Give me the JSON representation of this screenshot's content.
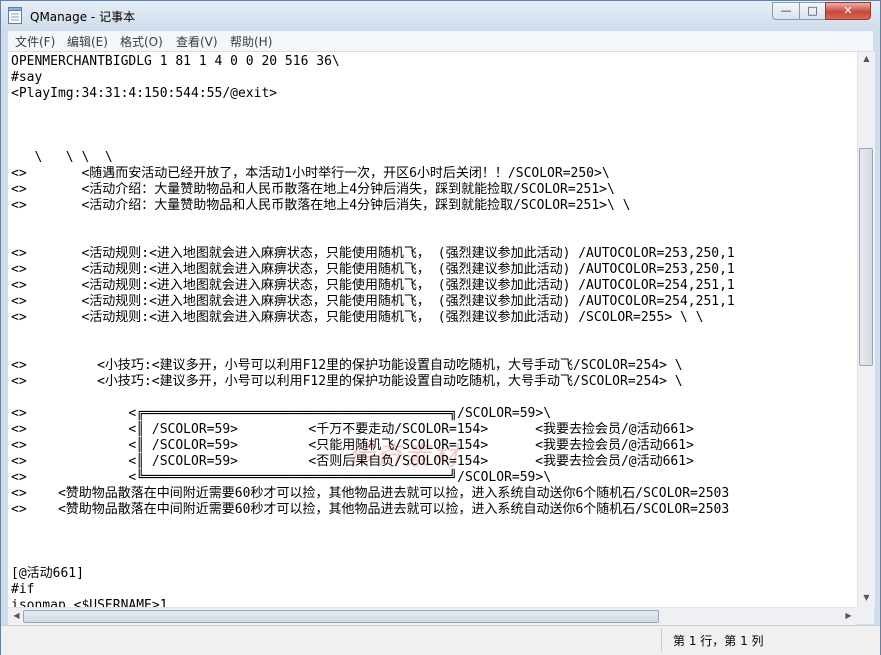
{
  "window": {
    "title": "QManage - 记事本",
    "buttons": {
      "minimize": "—",
      "maximize": "□",
      "close": "✕"
    }
  },
  "menu": {
    "items": [
      "文件(F)",
      "编辑(E)",
      "格式(O)",
      "查看(V)",
      "帮助(H)"
    ]
  },
  "editor": {
    "lines": [
      "OPENMERCHANTBIGDLG 1 81 1 4 0 0 20 516 36\\",
      "#say",
      "<PlayImg:34:31:4:150:544:55/@exit>",
      "",
      "",
      "",
      "   \\   \\ \\  \\",
      "<>       <随遇而安活动已经开放了，本活动1小时举行一次，开区6小时后关闭！！/SCOLOR=250>\\",
      "<>       <活动介绍：大量赞助物品和人民币散落在地上4分钟后消失，踩到就能捡取/SCOLOR=251>\\",
      "<>       <活动介绍：大量赞助物品和人民币散落在地上4分钟后消失，踩到就能捡取/SCOLOR=251>\\ \\",
      "",
      "",
      "<>       <活动规则:<进入地图就会进入麻痹状态，只能使用随机飞， (强烈建议参加此活动) /AUTOCOLOR=253,250,1",
      "<>       <活动规则:<进入地图就会进入麻痹状态，只能使用随机飞， (强烈建议参加此活动) /AUTOCOLOR=253,250,1",
      "<>       <活动规则:<进入地图就会进入麻痹状态，只能使用随机飞， (强烈建议参加此活动) /AUTOCOLOR=254,251,1",
      "<>       <活动规则:<进入地图就会进入麻痹状态，只能使用随机飞， (强烈建议参加此活动) /AUTOCOLOR=254,251,1",
      "<>       <活动规则:<进入地图就会进入麻痹状态，只能使用随机飞， (强烈建议参加此活动) /SCOLOR=255> \\ \\",
      "",
      "",
      "<>         <小技巧:<建议多开，小号可以利用F12里的保护功能设置自动吃随机，大号手动飞/SCOLOR=254> \\",
      "<>         <小技巧:<建议多开，小号可以利用F12里的保护功能设置自动吃随机，大号手动飞/SCOLOR=254> \\",
      "",
      "<>             <╔═══════════════════════════════════════╗/SCOLOR=59>\\",
      "<>             <║ /SCOLOR=59>         <千万不要走动/SCOLOR=154>      <我要去捡会员/@活动661>",
      "<>             <║ /SCOLOR=59>         <只能用随机飞/SCOLOR=154>      <我要去捡会员/@活动661>",
      "<>             <║ /SCOLOR=59>         <否则后果自负/SCOLOR=154>      <我要去捡会员/@活动661>",
      "<>             <╚═══════════════════════════════════════╝/SCOLOR=59>\\",
      "<>    <赞助物品散落在中间附近需要60秒才可以捡，其他物品进去就可以捡，进入系统自动送你6个随机石/SCOLOR=2503",
      "<>    <赞助物品散落在中间附近需要60秒才可以捡，其他物品进去就可以捡，进入系统自动送你6个随机石/SCOLOR=2503",
      "",
      "",
      "",
      "[@活动661]",
      "#if",
      "isonmap <$USERNAME>1"
    ]
  },
  "statusbar": {
    "position": "第 1 行，第 1 列"
  },
  "watermark": {
    "text": "传奇素材"
  }
}
